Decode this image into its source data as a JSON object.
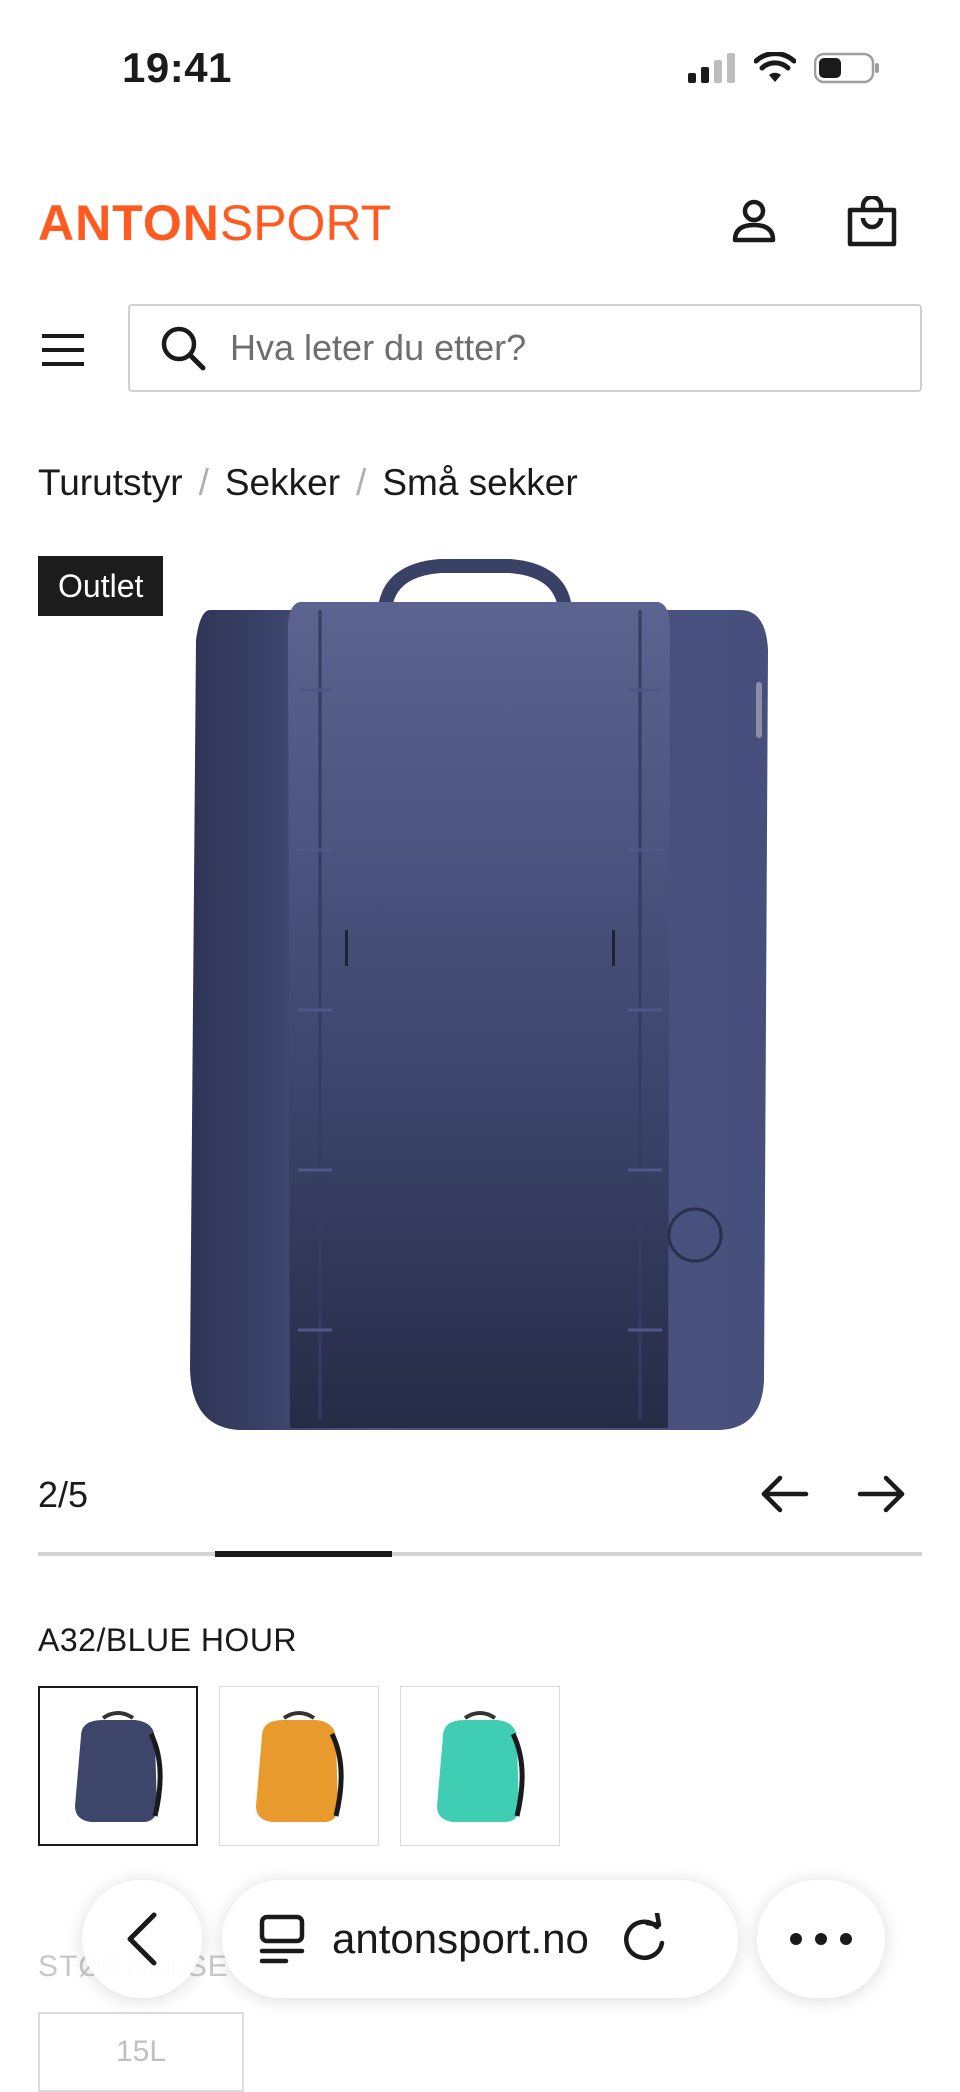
{
  "status_bar": {
    "time": "19:41"
  },
  "header": {
    "logo_bold": "ANTON",
    "logo_light": "SPORT",
    "account_icon": "user-icon",
    "cart_icon": "shopping-bag-icon"
  },
  "search": {
    "placeholder": "Hva leter du etter?",
    "value": ""
  },
  "breadcrumb": {
    "items": [
      "Turutstyr",
      "Sekker",
      "Små sekker"
    ],
    "separator": "/"
  },
  "badge": "Outlet",
  "gallery": {
    "counter": "2/5",
    "current": 2,
    "total": 5
  },
  "product": {
    "color_label": "A32/BLUE HOUR",
    "colors": [
      {
        "name": "blue hour",
        "hex": "#3d456b",
        "selected": true
      },
      {
        "name": "orange",
        "hex": "#e89a2c",
        "selected": false
      },
      {
        "name": "turquoise",
        "hex": "#3fcdb4",
        "selected": false
      }
    ],
    "size_label": "STØRRELSE",
    "size_options": [
      "15L"
    ]
  },
  "browser": {
    "url": "antonsport.no",
    "back_icon": "chevron-left-icon",
    "tabs_icon": "page-menu-icon",
    "reload_icon": "reload-icon",
    "more_icon": "more-icon"
  },
  "colors": {
    "brand": "#ff5a1f",
    "badge_bg": "#1c1c1c",
    "product": "#3d456b"
  }
}
